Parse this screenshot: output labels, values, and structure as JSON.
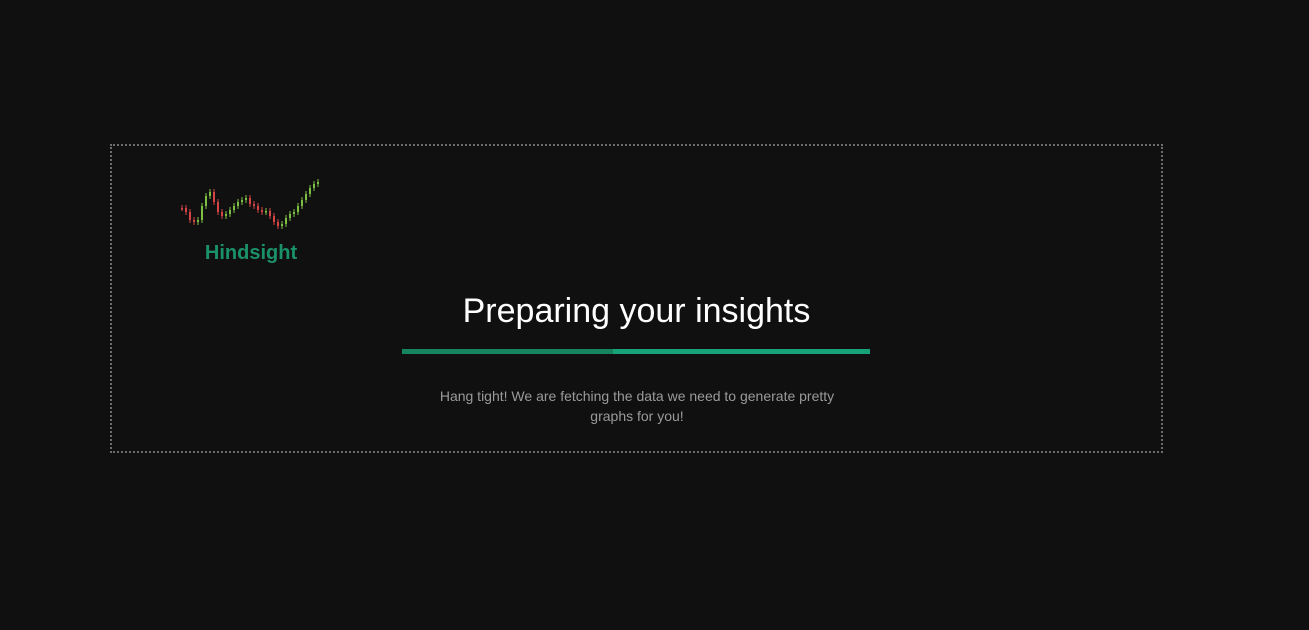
{
  "brand": {
    "name": "Hindsight",
    "logo_icon": "candlestick-chart-icon",
    "colors": {
      "up": "#7cbf43",
      "down": "#d64545",
      "brand": "#1a9169"
    }
  },
  "loader": {
    "title": "Preparing your insights",
    "message": "Hang tight! We are fetching the data we need to generate pretty graphs for you!",
    "progress": 0.45
  }
}
